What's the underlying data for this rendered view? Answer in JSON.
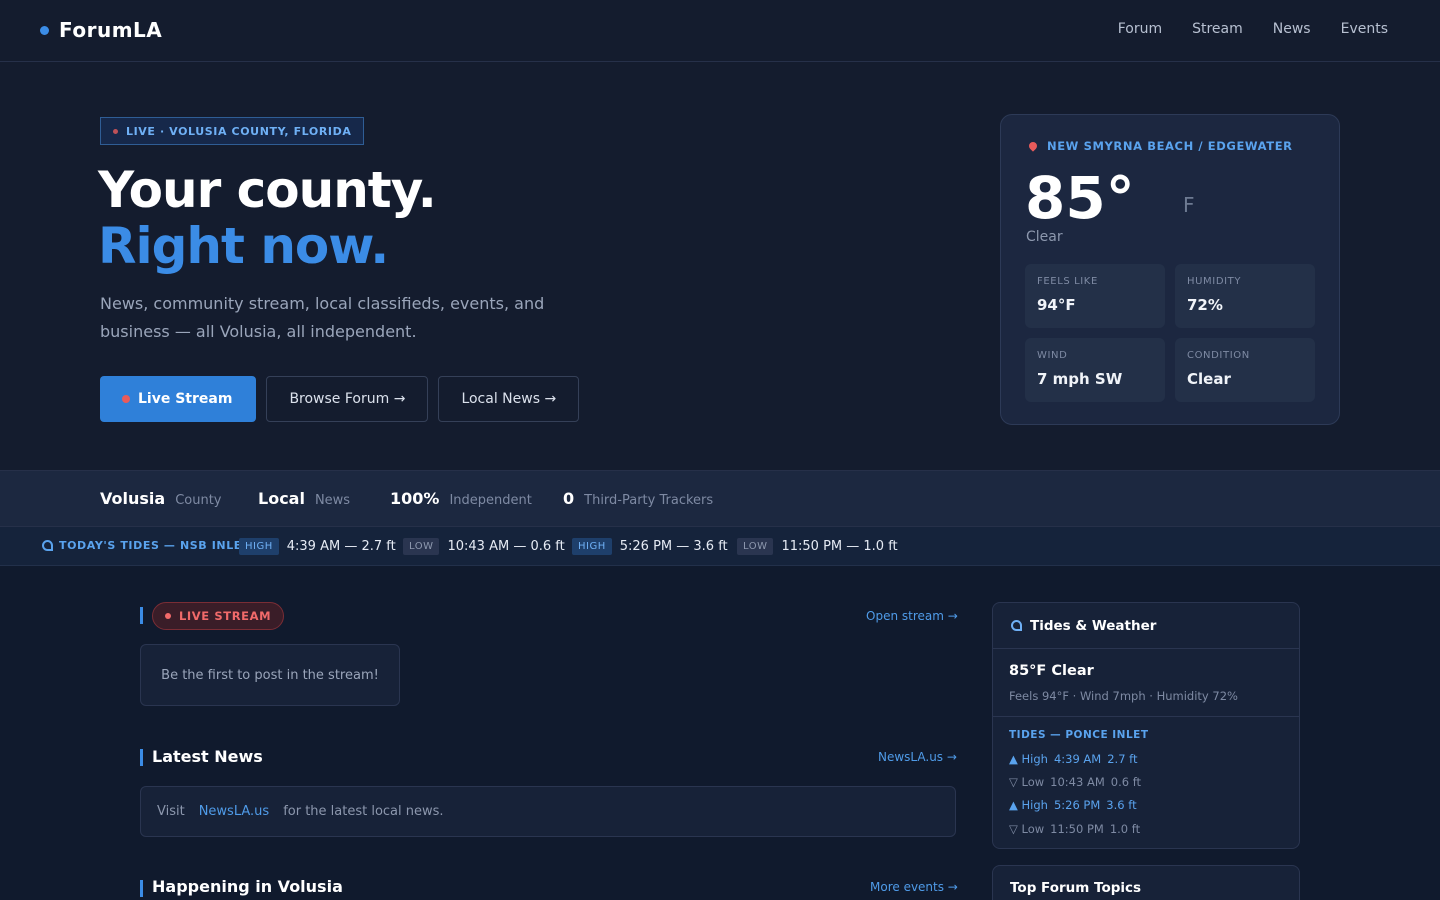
{
  "nav": {
    "brand": "ForumLA",
    "links": [
      "Forum",
      "Stream",
      "News",
      "Events"
    ]
  },
  "hero": {
    "badge": "LIVE · VOLUSIA COUNTY, FLORIDA",
    "headline_line1": "Your county.",
    "headline_line2": "Right now.",
    "lede": "News, community stream, local classifieds, events, and business — all Volusia, all independent.",
    "buttons": {
      "live": "Live Stream",
      "forum": "Browse Forum →",
      "news": "Local News →"
    }
  },
  "weather": {
    "location": "NEW SMYRNA BEACH / EDGEWATER",
    "temp": "85°",
    "unit": "F",
    "condition": "Clear",
    "stats": [
      {
        "label": "FEELS LIKE",
        "value": "94°F"
      },
      {
        "label": "HUMIDITY",
        "value": "72%"
      },
      {
        "label": "WIND",
        "value": "7 mph SW"
      },
      {
        "label": "CONDITION",
        "value": "Clear"
      }
    ]
  },
  "stats_bar": [
    {
      "big": "Volusia",
      "small": "County"
    },
    {
      "big": "Local",
      "small": "News"
    },
    {
      "big": "100%",
      "small": "Independent"
    },
    {
      "big": "0",
      "small": "Third-Party Trackers"
    }
  ],
  "tides": {
    "label": "TODAY'S TIDES — NSB INLET",
    "entries": [
      {
        "tag": "HIGH",
        "value": "4:39 AM — 2.7 ft"
      },
      {
        "tag": "LOW",
        "value": "10:43 AM — 0.6 ft"
      },
      {
        "tag": "HIGH",
        "value": "5:26 PM — 3.6 ft"
      },
      {
        "tag": "LOW",
        "value": "11:50 PM — 1.0 ft"
      }
    ]
  },
  "stream": {
    "badge": "LIVE STREAM",
    "open_link": "Open stream →",
    "empty": "Be the first to post in the stream!"
  },
  "news": {
    "title": "Latest News",
    "link": "NewsLA.us →",
    "visit": "Visit",
    "site": "NewsLA.us",
    "tail": "for the latest local news."
  },
  "events": {
    "title": "Happening in Volusia",
    "link": "More events →"
  },
  "sidebar": {
    "title": "Tides & Weather",
    "temp_line": "85°F  Clear",
    "sub": "Feels 94°F · Wind 7mph · Humidity 72%",
    "tides_title": "TIDES — PONCE INLET",
    "tides": [
      {
        "kind": "▲ High",
        "time": "4:39 AM",
        "height": "2.7 ft"
      },
      {
        "kind": "▽ Low",
        "time": "10:43 AM",
        "height": "0.6 ft"
      },
      {
        "kind": "▲ High",
        "time": "5:26 PM",
        "height": "3.6 ft"
      },
      {
        "kind": "▽ Low",
        "time": "11:50 PM",
        "height": "1.0 ft"
      }
    ],
    "forum_title": "Top Forum Topics"
  },
  "colors": {
    "background": "#141c2e",
    "accent": "#3b8ce6",
    "live_red": "#e85b5b"
  }
}
